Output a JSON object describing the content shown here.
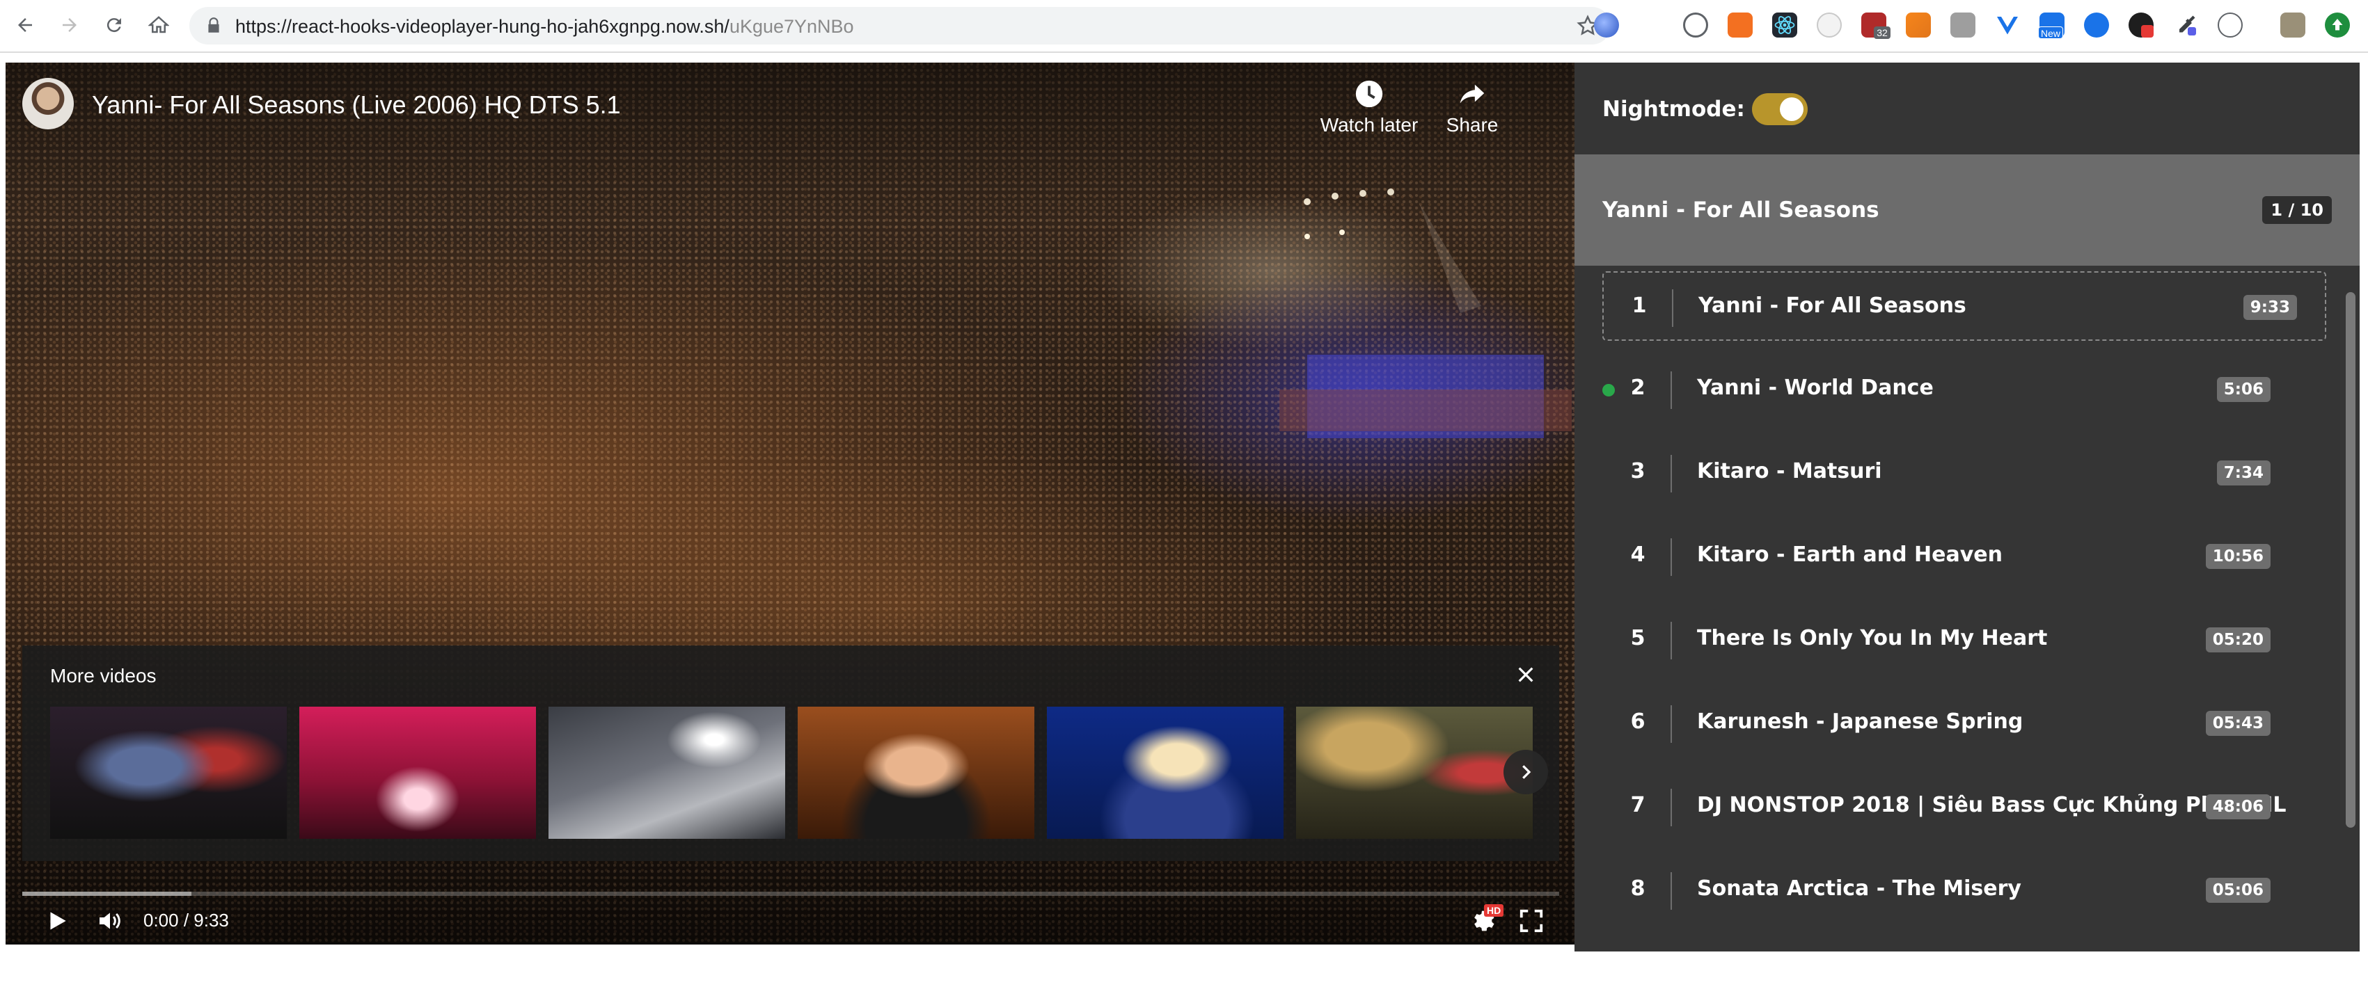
{
  "browser": {
    "url_host": "https://react-hooks-videoplayer-hung-ho-jah6xgnpg.now.sh/",
    "url_path": "uKgue7YnNBo",
    "extension_badges": [
      "32",
      "New"
    ]
  },
  "player": {
    "title": "Yanni- For All Seasons (Live 2006) HQ DTS 5.1",
    "watch_later_label": "Watch later",
    "share_label": "Share",
    "more_videos_label": "More videos",
    "time": "0:00 / 9:33",
    "progress_played": 0,
    "progress_loaded": 0.11,
    "hd_badge": "HD",
    "thumbnails": [
      "thumb-1",
      "thumb-2",
      "thumb-3",
      "thumb-4",
      "thumb-5",
      "thumb-6"
    ]
  },
  "sidebar": {
    "nightmode_label": "Nightmode:",
    "nightmode_on": true,
    "playlist_title": "Yanni - For All Seasons",
    "playlist_counter": "1 / 10",
    "items": [
      {
        "num": "1",
        "title": "Yanni - For All Seasons",
        "duration": "9:33",
        "active": true,
        "played": false
      },
      {
        "num": "2",
        "title": "Yanni - World Dance",
        "duration": "5:06",
        "active": false,
        "played": true
      },
      {
        "num": "3",
        "title": "Kitaro - Matsuri",
        "duration": "7:34",
        "active": false,
        "played": false
      },
      {
        "num": "4",
        "title": "Kitaro - Earth and Heaven",
        "duration": "10:56",
        "active": false,
        "played": false
      },
      {
        "num": "5",
        "title": "There Is Only You In My Heart",
        "duration": "05:20",
        "active": false,
        "played": false
      },
      {
        "num": "6",
        "title": "Karunesh - Japanese Spring",
        "duration": "05:43",
        "active": false,
        "played": false
      },
      {
        "num": "7",
        "title": "DJ NONSTOP 2018 | Siêu Bass Cực Khủng Phê SML",
        "duration": "48:06",
        "active": false,
        "played": false
      },
      {
        "num": "8",
        "title": "Sonata Arctica - The Misery",
        "duration": "05:06",
        "active": false,
        "played": false
      }
    ]
  },
  "colors": {
    "sidebar_bg": "#353535",
    "header_bg": "#6c6c6c",
    "toggle_on": "#b8952b",
    "played_dot": "#29a84a",
    "progress_red": "#ff0000"
  }
}
